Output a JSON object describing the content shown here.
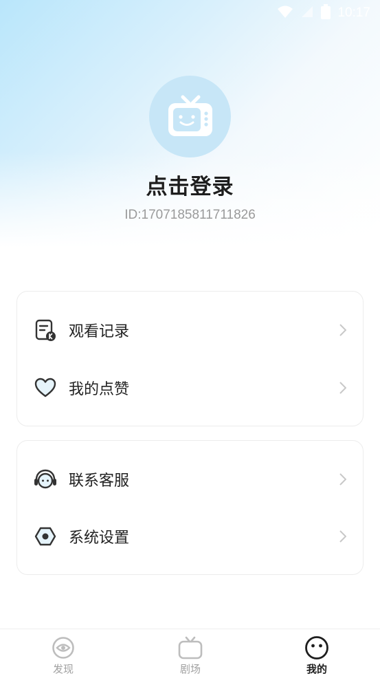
{
  "status_bar": {
    "time": "10:17"
  },
  "profile": {
    "login_text": "点击登录",
    "user_id": "ID:1707185811711826"
  },
  "menu_group_1": [
    {
      "label": "观看记录",
      "icon": "history-icon"
    },
    {
      "label": "我的点赞",
      "icon": "heart-icon"
    }
  ],
  "menu_group_2": [
    {
      "label": "联系客服",
      "icon": "headset-icon"
    },
    {
      "label": "系统设置",
      "icon": "settings-icon"
    }
  ],
  "bottom_nav": [
    {
      "label": "发现",
      "icon": "discover-icon",
      "active": false
    },
    {
      "label": "剧场",
      "icon": "tv-icon",
      "active": false
    },
    {
      "label": "我的",
      "icon": "smiley-icon",
      "active": true
    }
  ],
  "colors": {
    "accent_light": "#c7e6f7",
    "text_primary": "#222222",
    "text_muted": "#9a9a9a"
  }
}
